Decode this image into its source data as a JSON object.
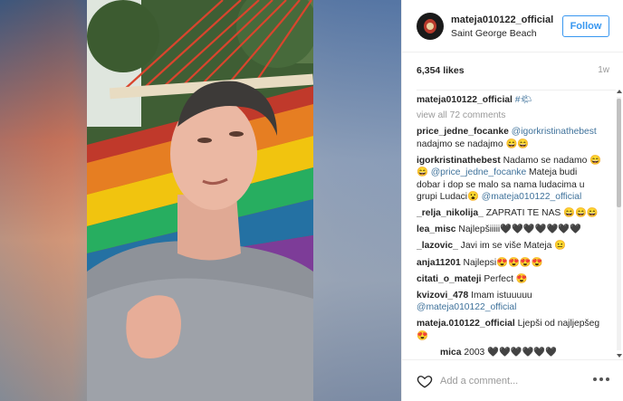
{
  "post": {
    "username": "mateja010122_official",
    "location": "Saint George Beach",
    "follow_label": "Follow",
    "likes": "6,354 likes",
    "age": "1w",
    "caption_user": "mateja010122_official",
    "caption_text": "#🌤",
    "view_all": "view all 72 comments"
  },
  "comments": [
    {
      "user": "price_jedne_focanke",
      "mention": "@igorkristinathebest",
      "text": " nadajmo se nadajmo 😄😄"
    },
    {
      "user": "igorkristinathebest",
      "text": "Nadamo se nadamo 😄😄 ",
      "mention": "@price_jedne_focanke",
      "text2": " Mateja budi dobar i dop se malo sa nama ludacima u grupi Ludaci😮 ",
      "mention2": "@mateja010122_official"
    },
    {
      "user": "_relja_nikolija_",
      "text": "ZAPRATI TE NAS 😄😄😄"
    },
    {
      "user": "lea_misc",
      "text": "Najlepšiiiii🖤🖤🖤🖤🖤🖤🖤"
    },
    {
      "user": "_lazovic_",
      "text": "Javi im se više Mateja 😐"
    },
    {
      "user": "anja11201",
      "text": "Najlepsi😍😍😍😍"
    },
    {
      "user": "citati_o_mateji",
      "text": "Perfect 😍"
    },
    {
      "user": "kvizovi_478",
      "text": "Imam istuuuuu ",
      "mention": "@mateja010122_official"
    },
    {
      "user": "mateja.010122_official",
      "text": "Ljepši od najljepšeg 😍"
    },
    {
      "user": "mica",
      "text": "2003 🖤🖤🖤🖤🖤🖤"
    }
  ],
  "footer": {
    "placeholder": "Add a comment...",
    "heart_icon": "heart-outline-icon",
    "more_icon": "more-options-icon"
  },
  "colors": {
    "link": "#3f729b",
    "follow": "#3897f0",
    "muted": "#999999"
  }
}
